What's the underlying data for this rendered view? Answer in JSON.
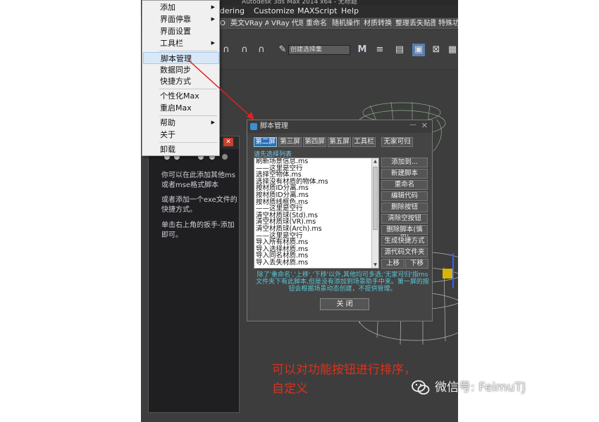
{
  "window": {
    "title": "Autodesk 3ds Max 2014 x64 - 无标题"
  },
  "menubar": {
    "items": [
      "endering",
      "Customize",
      "MAXScript",
      "Help"
    ]
  },
  "toolbar1": {
    "items": [
      "O",
      "英文VRay AO",
      "VRay 代理",
      "重命名",
      "随机操作",
      "材质转换",
      "整理丢失贴图",
      "特殊功"
    ]
  },
  "toolbar2": {
    "selection_set": "创建选择集"
  },
  "context_menu": {
    "items": [
      {
        "label": "添加",
        "submenu": true
      },
      {
        "label": "界面停靠",
        "submenu": true
      },
      {
        "label": "界面设置",
        "submenu": false
      },
      {
        "label": "工具栏",
        "submenu": true
      },
      {
        "label": "脚本管理",
        "submenu": false,
        "highlighted": true
      },
      {
        "label": "数据同步",
        "submenu": false
      },
      {
        "label": "快捷方式",
        "submenu": false
      },
      {
        "label": "个性化Max",
        "submenu": false
      },
      {
        "label": "重启Max",
        "submenu": false
      },
      {
        "label": "帮助",
        "submenu": true
      },
      {
        "label": "关于",
        "submenu": false
      },
      {
        "label": "卸载",
        "submenu": false
      }
    ]
  },
  "left_panel": {
    "close_label": "✕",
    "text1": "你可以在此添加其他ms或者mse格式脚本",
    "text2": "或者添加一个exe文件的快捷方式。",
    "text3": "单击右上角的扳手-添加即可。"
  },
  "dialog": {
    "title": "脚本管理",
    "tabs": [
      "第二屏",
      "第三屏",
      "第四屏",
      "第五屏",
      "工具栏",
      "无家可归"
    ],
    "active_tab": 0,
    "hint": "请先选择列表",
    "list": [
      "刷新场景信息.ms",
      "——这里是空行",
      "选择空物体.ms",
      "选择没有材质的物体.ms",
      "按材质ID分离.ms",
      "按材质ID分离.ms",
      "按材质线框色.ms",
      "——这里是空行",
      "清空材质球(Std).ms",
      "清空材质球(VR).ms",
      "清空材质球(Arch).ms",
      "——这里是空行",
      "导入所有材质.ms",
      "导入选择材质.ms",
      "导入同名材质.ms",
      "导入丢失材质.ms"
    ],
    "actions": [
      "添加到...",
      "新建脚本",
      "重命名",
      "编辑代码",
      "删除按钮",
      "清除空按钮",
      "删除脚本(慎用)",
      "生成快捷方式",
      "源代码文件夹"
    ],
    "up_label": "上移",
    "down_label": "下移",
    "note": "除了'重命名','上移','下移'以外,其他均可多选;'无家可归'指ms文件夹下有此脚本,但是没有添加到场景助手中来。第一屏的按钮会根据场景动态创建，不提供管理。",
    "close_label": "关 闭"
  },
  "annotation": {
    "caption_line1": "可以对功能按钮进行排序，",
    "caption_line2": "自定义",
    "watermark": "微信号: FeimuTJ"
  },
  "colors": {
    "caption_red": "#d8321f",
    "tab_active": "#2d6fb8",
    "dialog_bg": "#444444",
    "note_cyan": "#5ac8d8"
  }
}
